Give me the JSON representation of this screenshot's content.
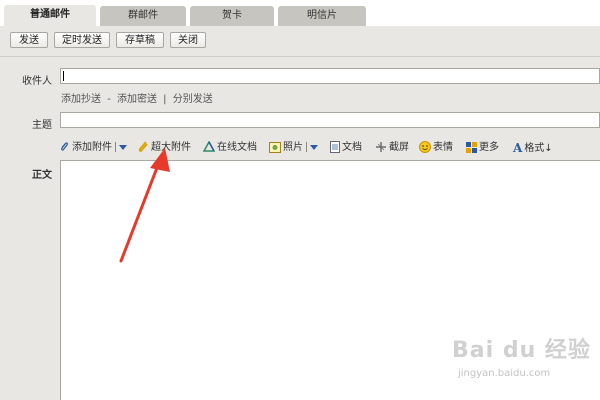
{
  "tabs": [
    {
      "label": "普通邮件",
      "active": true
    },
    {
      "label": "群邮件",
      "active": false
    },
    {
      "label": "贺卡",
      "active": false
    },
    {
      "label": "明信片",
      "active": false
    }
  ],
  "toolbar": {
    "send_label": "发送",
    "scheduled_send_label": "定时发送",
    "save_draft_label": "存草稿",
    "close_label": "关闭"
  },
  "compose": {
    "recipient_label": "收件人",
    "recipient_value": "",
    "add_cc_label": "添加抄送",
    "link_sep_1": "-",
    "add_bcc_label": "添加密送",
    "link_sep_2": "|",
    "separate_send_label": "分别发送",
    "subject_label": "主题",
    "subject_value": "",
    "body_label": "正文"
  },
  "attach_bar": {
    "add_attachment_label": "添加附件",
    "large_attachment_label": "超大附件",
    "online_doc_label": "在线文档",
    "photo_label": "照片",
    "document_label": "文档",
    "screenshot_label": "截屏",
    "emoji_label": "表情",
    "more_label": "更多",
    "format_label": "格式↓"
  },
  "watermark": {
    "text": "Bai du 经验",
    "sub": "jingyan.baidu.com"
  },
  "colors": {
    "panel_bg": "#e8e7e3",
    "tab_inactive": "#c7c5bf",
    "arrow_red": "#e8392b",
    "icon_blue": "#2c5aa0"
  }
}
